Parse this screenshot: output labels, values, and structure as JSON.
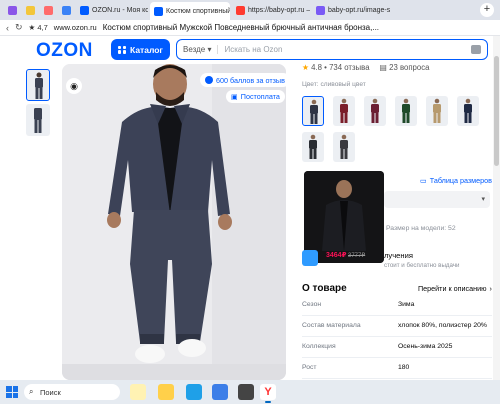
{
  "browser": {
    "tabs": [
      {
        "label": "",
        "color": "#8a56e8"
      },
      {
        "label": "",
        "color": "#f3c63a"
      },
      {
        "label": "",
        "color": "#ff6b6b"
      },
      {
        "label": "",
        "color": "#3b82f6"
      },
      {
        "label": "OZON.ru - Моя корзина",
        "color": "#005bff"
      },
      {
        "label": "Костюм спортивный М",
        "color": "#005bff",
        "active": true
      },
      {
        "label": "https://baby-opt.ru — Ян",
        "color": "#ff3b30"
      },
      {
        "label": "baby-opt.ru/image-search",
        "color": "#7a5af5"
      }
    ],
    "close_glyph": "×",
    "new_tab_glyph": "+",
    "address": {
      "rating": "4,7",
      "url": "www.ozon.ru",
      "page_title": "Костюм спортивный Мужской Повседневный брючный античная бронза,..."
    }
  },
  "header": {
    "logo": "OZON",
    "catalog_label": "Каталог",
    "search_scope": "Везде",
    "search_placeholder": "Искать на Ozon"
  },
  "gallery": {
    "points_badge": "600 баллов за отзыв",
    "postpay_badge": "Постоплата"
  },
  "product": {
    "rating": "4.8 • 734 отзыва",
    "questions": "23 вопроса",
    "color_label": "Цвет: сливовый цвет",
    "swatch_colors": [
      "#2e3445",
      "#7a1e2a",
      "#6b1f33",
      "#1f4a2a",
      "#b79a6e",
      "#1f2a44",
      "#2a2d33",
      "#3a3a3f"
    ],
    "popup_price": "3464₽",
    "popup_old_price": "3777₽",
    "size_table_link": "Таблица размеров",
    "model_size": "Размер на модели: 52",
    "delivery_title": "лучения",
    "delivery_sub": "стоит и бесплатно выдачи",
    "about_title": "О товаре",
    "about_link": "Перейти к описанию",
    "specs": [
      {
        "key": "Сезон",
        "value": "Зима"
      },
      {
        "key": "Состав материала",
        "value": "хлопок 80%, полиэстер 20%"
      },
      {
        "key": "Коллекция",
        "value": "Осень-зима 2025"
      },
      {
        "key": "Рост",
        "value": "180"
      }
    ]
  },
  "taskbar": {
    "search_label": "Поиск"
  }
}
